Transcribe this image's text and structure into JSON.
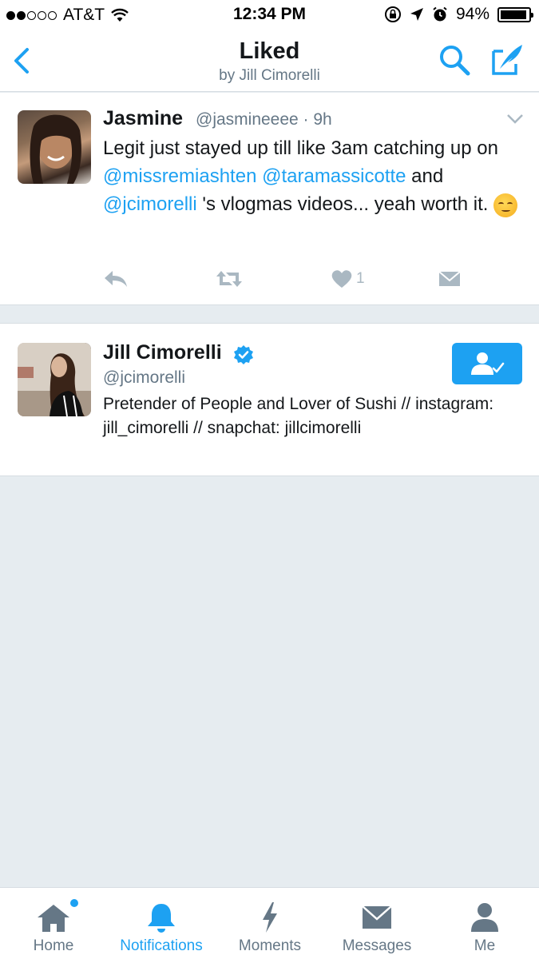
{
  "status_bar": {
    "carrier": "AT&T",
    "time": "12:34 PM",
    "battery": "94%",
    "battery_level": 0.94,
    "signal_bars_filled": 2,
    "signal_bars_total": 5
  },
  "nav": {
    "title": "Liked",
    "subtitle": "by Jill Cimorelli",
    "accent_color": "#1da1f2"
  },
  "tweet": {
    "name": "Jasmine",
    "handle": "@jasmineeee · 9h",
    "text_parts": {
      "p1": "Legit just stayed up till like 3am catching up on ",
      "m1": "@missremiashten",
      "p2": " ",
      "m2": "@taramassicotte",
      "p3": " and ",
      "m3": "@jcimorelli",
      "p4": " 's vlogmas videos... yeah worth it. "
    },
    "emoji": "smirking-face",
    "like_count": "1"
  },
  "profile": {
    "name": "Jill Cimorelli",
    "handle": "@jcimorelli",
    "bio": "Pretender of People and Lover of Sushi // instagram: jill_cimorelli // snapchat: jillcimorelli",
    "verified": true
  },
  "tabs": [
    {
      "label": "Home",
      "icon": "home-icon",
      "has_dot": true
    },
    {
      "label": "Notifications",
      "icon": "bell-icon",
      "active": true
    },
    {
      "label": "Moments",
      "icon": "lightning-icon"
    },
    {
      "label": "Messages",
      "icon": "envelope-icon"
    },
    {
      "label": "Me",
      "icon": "person-icon"
    }
  ]
}
